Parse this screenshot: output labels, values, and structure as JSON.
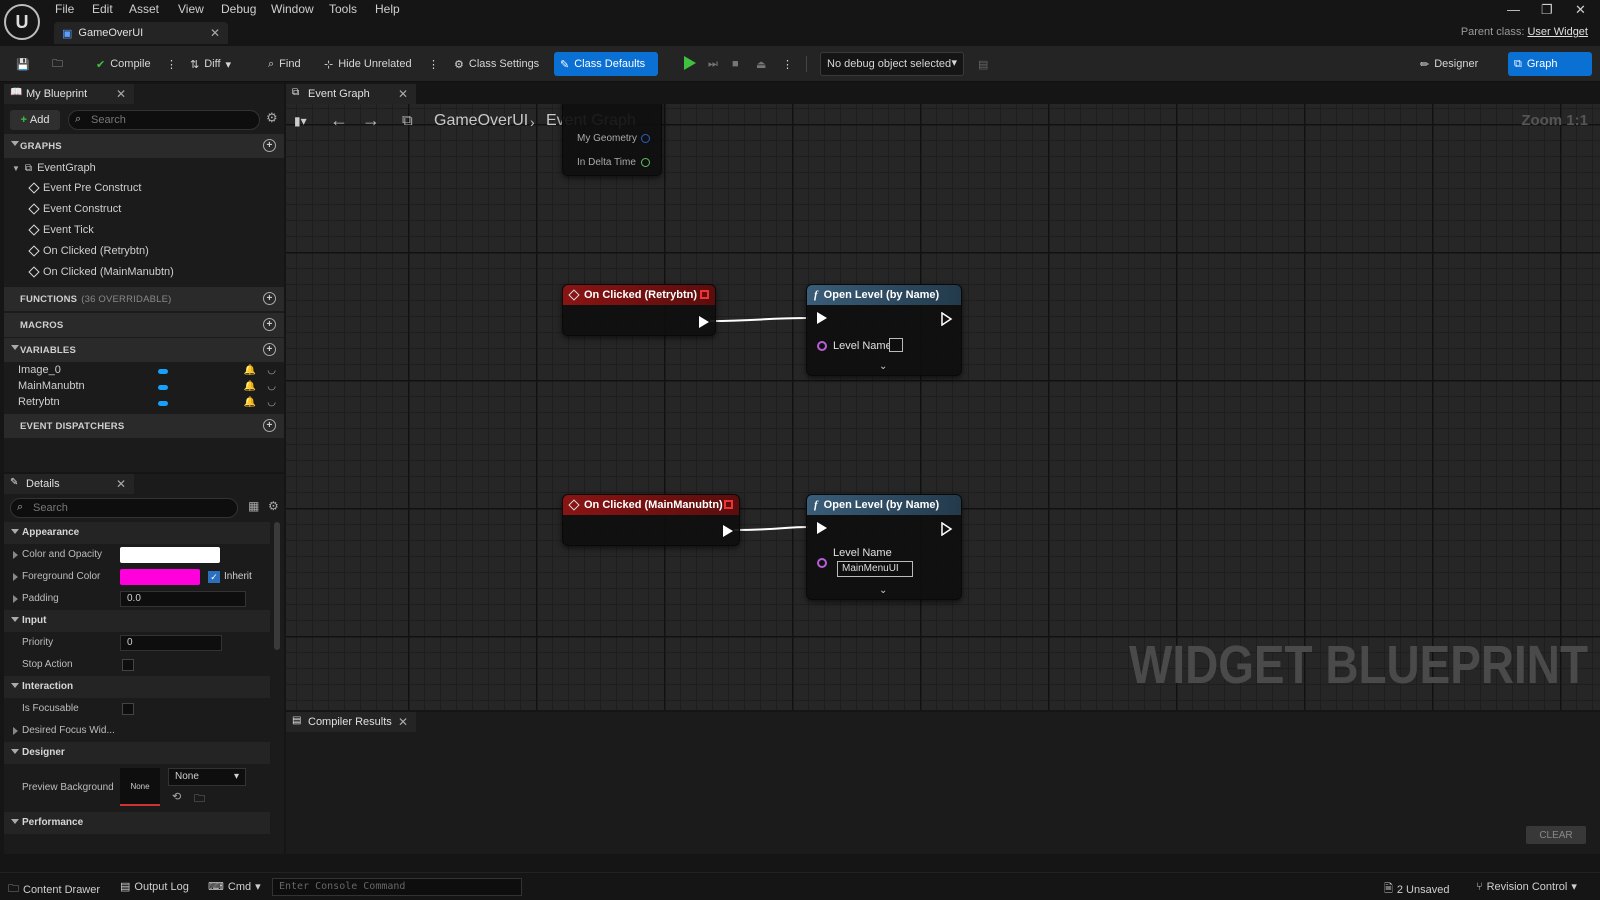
{
  "menu": [
    "File",
    "Edit",
    "Asset",
    "View",
    "Debug",
    "Window",
    "Tools",
    "Help"
  ],
  "doc_tab": "GameOverUI",
  "parent_class": {
    "label": "Parent class:",
    "value": "User Widget"
  },
  "toolbar": {
    "compile": "Compile",
    "diff": "Diff",
    "find": "Find",
    "hide_unrelated": "Hide Unrelated",
    "class_settings": "Class Settings",
    "class_defaults": "Class Defaults",
    "debug_object": "No debug object selected",
    "designer": "Designer",
    "graph": "Graph"
  },
  "my_blueprint": {
    "tab": "My Blueprint",
    "add": "Add",
    "search_placeholder": "Search",
    "sections": {
      "graphs": "GRAPHS",
      "functions": "FUNCTIONS",
      "functions_sub": "(36 OVERRIDABLE)",
      "macros": "MACROS",
      "variables": "VARIABLES",
      "dispatchers": "EVENT DISPATCHERS"
    },
    "event_graph": "EventGraph",
    "events": [
      "Event Pre Construct",
      "Event Construct",
      "Event Tick",
      "On Clicked (Retrybtn)",
      "On Clicked (MainManubtn)"
    ],
    "variables": [
      "Image_0",
      "MainManubtn",
      "Retrybtn"
    ]
  },
  "details": {
    "tab": "Details",
    "search_placeholder": "Search",
    "appearance": "Appearance",
    "color_opacity": "Color and Opacity",
    "foreground_color": "Foreground Color",
    "inherit": "Inherit",
    "padding": "Padding",
    "padding_value": "0.0",
    "input": "Input",
    "priority": "Priority",
    "priority_value": "0",
    "stop_action": "Stop Action",
    "interaction": "Interaction",
    "is_focusable": "Is Focusable",
    "desired_focus": "Desired Focus Wid...",
    "designer": "Designer",
    "preview_bg": "Preview Background",
    "preview_none": "None",
    "preview_select": "None",
    "performance": "Performance",
    "colors": {
      "color_opacity": "#ffffff",
      "foreground": "#ff00dd"
    }
  },
  "graph": {
    "tab": "Event Graph",
    "crumb_root": "GameOverUI",
    "crumb_leaf": "Event Graph",
    "zoom": "Zoom 1:1",
    "watermark": "WIDGET BLUEPRINT",
    "tick_pins": [
      "My Geometry",
      "In Delta Time"
    ],
    "nodes": {
      "retry_event": "On Clicked (Retrybtn)",
      "main_event": "On Clicked (MainManubtn)",
      "open_level_1": "Open Level (by Name)",
      "open_level_2": "Open Level (by Name)",
      "level_name_label": "Level Name",
      "level_name_value_2": "MainMenuUI"
    }
  },
  "compiler": {
    "tab": "Compiler Results",
    "clear": "CLEAR"
  },
  "statusbar": {
    "content_drawer": "Content Drawer",
    "output_log": "Output Log",
    "cmd": "Cmd",
    "console_placeholder": "Enter Console Command",
    "unsaved": "2 Unsaved",
    "revision": "Revision Control"
  }
}
